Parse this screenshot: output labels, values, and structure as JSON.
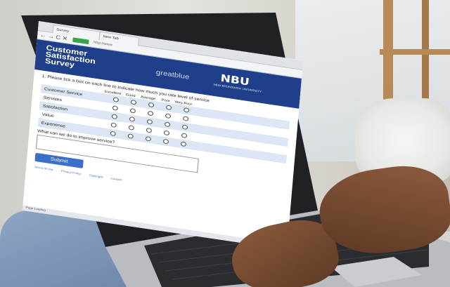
{
  "browser": {
    "tabs": [
      "Survey",
      "New Tab"
    ],
    "address_bar": "http://www",
    "nav_icons": "←→C✕",
    "secure_label": "Secure",
    "status_bar": "Page Loading"
  },
  "survey": {
    "title_lines": [
      "Customer",
      "Satisfaction",
      "Survey"
    ],
    "brand_left": "greatblue",
    "brand_right": "NBU",
    "brand_right_sub": "NEW BRUNSWICK UNIVERSITY",
    "question_1": "1. Please tick a box on each line to indicate how much you rate level of service",
    "columns": [
      "Excellent",
      "Good",
      "Average",
      "Poor",
      "Very Poor"
    ],
    "rows": [
      "Customer Service",
      "Services",
      "Satisfaction",
      "Value",
      "Experience"
    ],
    "question_2": "What can we do to improve service?",
    "submit_label": "Submit",
    "footer_links": [
      "Terms of Use",
      "Privacy Policy",
      "Copyright",
      "Contact"
    ]
  },
  "colors": {
    "header_blue": "#1f3f8a",
    "submit_blue": "#3b6fc9",
    "row_tint": "#dde6f4"
  }
}
